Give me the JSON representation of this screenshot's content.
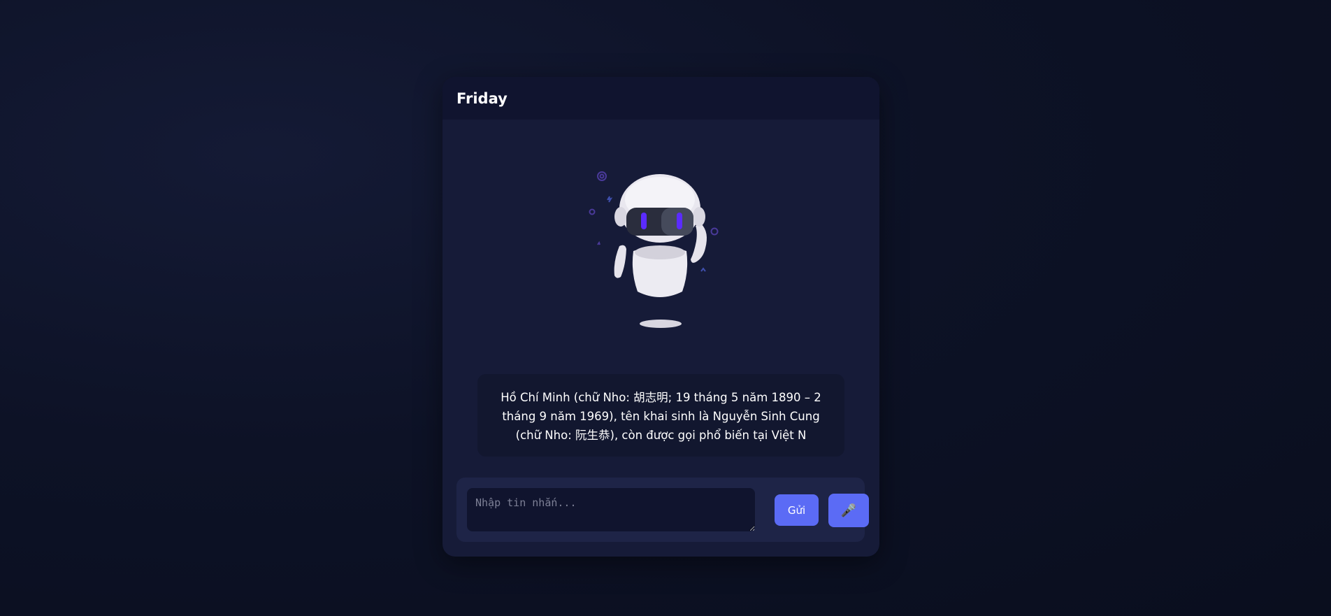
{
  "app": {
    "title": "Friday"
  },
  "assistant": {
    "avatar_icon": "robot-icon",
    "message": "Hồ Chí Minh (chữ Nho: 胡志明; 19 tháng 5 năm 1890 – 2 tháng 9 năm 1969), tên khai sinh là Nguyễn Sinh Cung (chữ Nho: 阮生恭), còn được gọi phổ biến tại Việt N"
  },
  "composer": {
    "placeholder": "Nhập tin nhắn...",
    "value": "",
    "send_label": "Gửi",
    "mic_icon": "microphone-icon",
    "mic_glyph": "🎤"
  },
  "colors": {
    "accent": "#5b6bf5",
    "background": "#0d1226",
    "card": "#161b38",
    "header": "#10142f",
    "robot_eye": "#5b2bff"
  }
}
